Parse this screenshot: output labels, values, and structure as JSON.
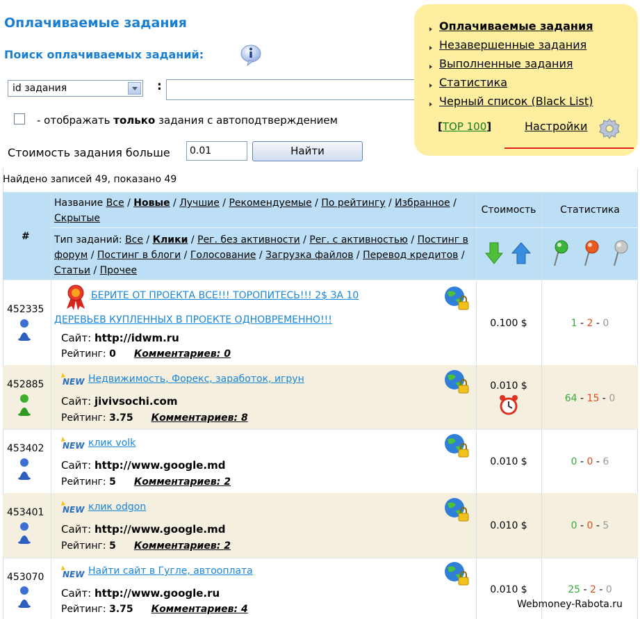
{
  "page": {
    "title": "Оплачиваемые задания",
    "search_title": "Поиск оплачиваемых заданий:"
  },
  "search": {
    "select_value": "id задания",
    "colon": ":",
    "checkbox_label_pre": "- отображать ",
    "checkbox_label_bold": "только",
    "checkbox_label_post": " задания с автоподтверждением",
    "cost_label": "Стоимость задания больше",
    "cost_value": "0.01",
    "find_button": "Найти"
  },
  "menu": {
    "items": [
      "Оплачиваемые задания",
      "Незавершенные задания",
      "Выполненные задания",
      "Статистика",
      "Черный список (Black List)"
    ],
    "top100_open": "[",
    "top100": "TOP 100",
    "top100_close": "]",
    "settings": "Настройки"
  },
  "table": {
    "found_text": "Найдено записей 49, показано 49",
    "col_id": "#",
    "col_cost": "Стоимость",
    "col_stats": "Статистика",
    "name_label": "Название",
    "name_filters": [
      "Все",
      "Новые",
      "Лучшие",
      "Рекомендуемые",
      "По рейтингу",
      "Избранное",
      "Скрытые"
    ],
    "type_label": "Тип заданий:",
    "type_filters": [
      "Все",
      "Клики",
      "Рег. без активности",
      "Рег. с активностью",
      "Постинг в форум",
      "Постинг в блоги",
      "Голосование",
      "Загрузка файлов",
      "Перевод кредитов",
      "Статьи",
      "Прочее"
    ],
    "sep": " / ",
    "site_label": "Сайт:",
    "rating_label": "Рейтинг:",
    "comments_label": "Комментариев:",
    "new_badge": "NEW",
    "rows": [
      {
        "id": "452335",
        "title1": "БЕРИТЕ ОТ ПРОЕКТА ВСЕ!!! ТОРОПИТЕСЬ!!! 2$ ЗА 10",
        "title2": "ДЕРЕВЬЕВ КУПЛЕННЫХ В ПРОЕКТЕ ОДНОВРЕМЕННО!!!",
        "site": "http://idwm.ru",
        "rating": "0",
        "comments": "0",
        "price": "0.100 $",
        "s1": "1",
        "s2": "2",
        "s3": "0"
      },
      {
        "id": "452885",
        "title1": "Недвижимость, Форекс, заработок, игрун",
        "site": "jivivsochi.com",
        "rating": "3.75",
        "comments": "8",
        "price": "0.010 $",
        "s1": "64",
        "s2": "15",
        "s3": "0"
      },
      {
        "id": "453402",
        "title1": "клик volk",
        "site": "http://www.google.md",
        "rating": "5",
        "comments": "2",
        "price": "0.010 $",
        "s1": "0",
        "s2": "0",
        "s3": "6"
      },
      {
        "id": "453401",
        "title1": "клик odgon",
        "site": "http://www.google.md",
        "rating": "5",
        "comments": "2",
        "price": "0.010 $",
        "s1": "0",
        "s2": "0",
        "s3": "5"
      },
      {
        "id": "453070",
        "title1": "Найти сайт в Гугле, автооплата",
        "site": "http://www.google.ru",
        "rating": "3.75",
        "comments": "4",
        "price": "0.010 $",
        "s1": "25",
        "s2": "2",
        "s3": "0"
      }
    ]
  },
  "watermark": "Webmoney-Rabota.ru"
}
